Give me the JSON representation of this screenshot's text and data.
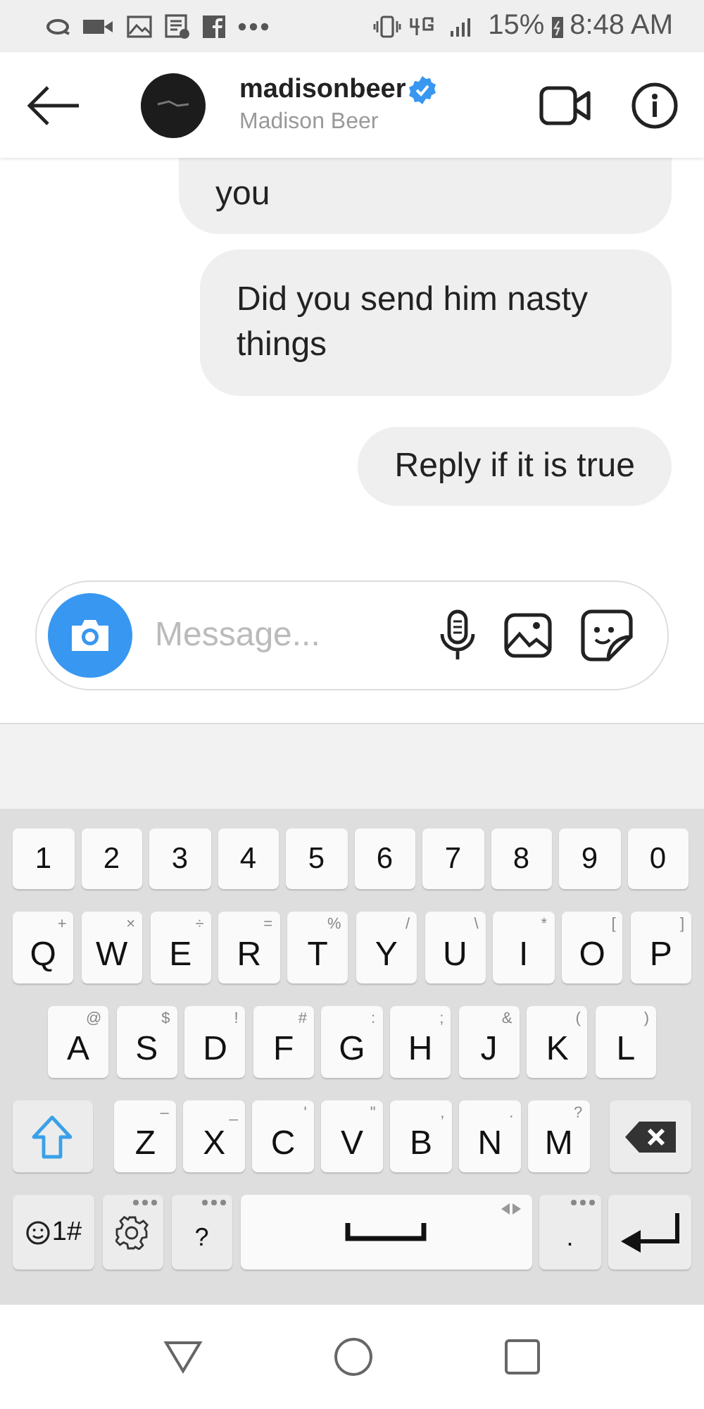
{
  "status_bar": {
    "battery": "15%",
    "time": "8:48 AM"
  },
  "header": {
    "username": "madisonbeer",
    "verified": true,
    "full_name": "Madison Beer"
  },
  "messages": [
    {
      "text": "you",
      "cut": true
    },
    {
      "text": "Did you send him nasty things",
      "cut": false
    },
    {
      "text": "Reply if it is true",
      "cut": false
    }
  ],
  "composer": {
    "placeholder": "Message..."
  },
  "keyboard": {
    "rows": [
      [
        {
          "kind": "char",
          "label": "1"
        },
        {
          "kind": "char",
          "label": "2"
        },
        {
          "kind": "char",
          "label": "3"
        },
        {
          "kind": "char",
          "label": "4"
        },
        {
          "kind": "char",
          "label": "5"
        },
        {
          "kind": "char",
          "label": "6"
        },
        {
          "kind": "char",
          "label": "7"
        },
        {
          "kind": "char",
          "label": "8"
        },
        {
          "kind": "char",
          "label": "9"
        },
        {
          "kind": "char",
          "label": "0"
        }
      ],
      [
        {
          "kind": "letter",
          "label": "Q",
          "hint": "+"
        },
        {
          "kind": "letter",
          "label": "W",
          "hint": "×"
        },
        {
          "kind": "letter",
          "label": "E",
          "hint": "÷"
        },
        {
          "kind": "letter",
          "label": "R",
          "hint": "="
        },
        {
          "kind": "letter",
          "label": "T",
          "hint": "%"
        },
        {
          "kind": "letter",
          "label": "Y",
          "hint": "/"
        },
        {
          "kind": "letter",
          "label": "U",
          "hint": "\\"
        },
        {
          "kind": "letter",
          "label": "I",
          "hint": "*"
        },
        {
          "kind": "letter",
          "label": "O",
          "hint": "["
        },
        {
          "kind": "letter",
          "label": "P",
          "hint": "]"
        }
      ],
      [
        {
          "kind": "letter",
          "label": "A",
          "hint": "@"
        },
        {
          "kind": "letter",
          "label": "S",
          "hint": "$"
        },
        {
          "kind": "letter",
          "label": "D",
          "hint": "!"
        },
        {
          "kind": "letter",
          "label": "F",
          "hint": "#"
        },
        {
          "kind": "letter",
          "label": "G",
          "hint": ":"
        },
        {
          "kind": "letter",
          "label": "H",
          "hint": ";"
        },
        {
          "kind": "letter",
          "label": "J",
          "hint": "&"
        },
        {
          "kind": "letter",
          "label": "K",
          "hint": "("
        },
        {
          "kind": "letter",
          "label": "L",
          "hint": ")"
        }
      ],
      [
        {
          "kind": "shift"
        },
        {
          "kind": "letter",
          "label": "Z",
          "hint": "–"
        },
        {
          "kind": "letter",
          "label": "X",
          "hint": "_"
        },
        {
          "kind": "letter",
          "label": "C",
          "hint": "'"
        },
        {
          "kind": "letter",
          "label": "V",
          "hint": "\""
        },
        {
          "kind": "letter",
          "label": "B",
          "hint": ","
        },
        {
          "kind": "letter",
          "label": "N",
          "hint": "."
        },
        {
          "kind": "letter",
          "label": "M",
          "hint": "?"
        },
        {
          "kind": "backspace"
        }
      ],
      [
        {
          "kind": "symbols",
          "label": "1#"
        },
        {
          "kind": "settings",
          "more": true
        },
        {
          "kind": "small",
          "label": "?",
          "more": true
        },
        {
          "kind": "space"
        },
        {
          "kind": "small",
          "label": ".",
          "more": true
        },
        {
          "kind": "enter"
        }
      ]
    ]
  }
}
